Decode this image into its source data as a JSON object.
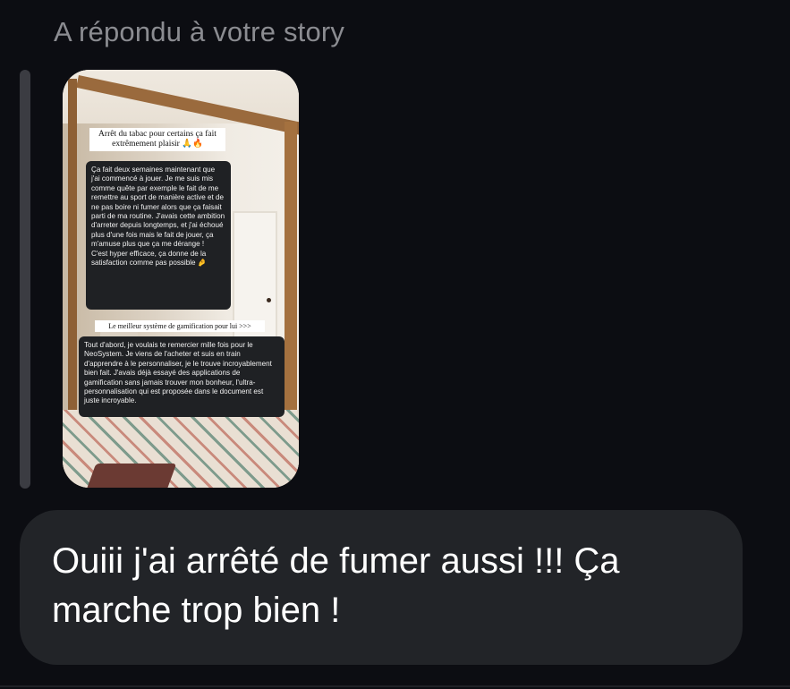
{
  "reply": {
    "label": "A répondu à votre story"
  },
  "story": {
    "caption_top": "Arrêt du tabac pour certains ça fait extrêmement plaisir 🙏🔥",
    "message_one": "Ça fait deux semaines maintenant que j'ai commencé à jouer. Je me suis mis comme quête par exemple le fait de me remettre au sport de manière active et de ne pas boire ni fumer alors que ça faisait parti de ma routine. J'avais cette ambition d'arreter depuis longtemps, et j'ai échoué plus d'une fois mais le fait de jouer, ça m'amuse plus que ça me dérange !\nC'est hyper efficace, ça donne de la satisfaction comme pas possible 🤌",
    "caption_middle": "Le meilleur système de gamification pour lui >>>",
    "message_two": "Tout d'abord, je voulais te remercier mille fois pour le NeoSystem. Je viens de l'acheter et suis en train d'apprendre à le personnaliser, je le trouve incroyablement bien fait. J'avais déjà essayé des applications de gamification sans jamais trouver mon bonheur, l'ultra-personnalisation qui est proposée dans le document est juste incroyable."
  },
  "message": {
    "text": "Ouiii j'ai arrêté de fumer aussi !!! Ça marche trop bien !"
  },
  "colors": {
    "background": "#0c0d12",
    "bubble": "#222428",
    "label": "#8b8c91",
    "text": "#ffffff"
  }
}
